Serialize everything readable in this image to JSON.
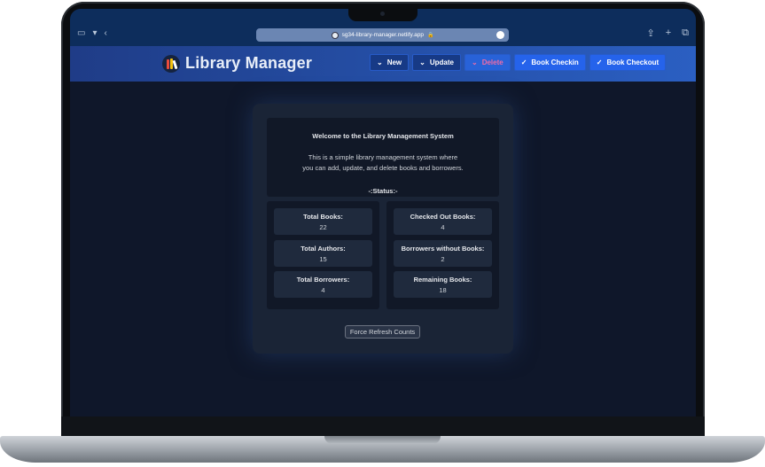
{
  "browser": {
    "url": "sg34-library-manager.netlify.app",
    "lock_glyph": "🔒"
  },
  "app": {
    "title": "Library Manager"
  },
  "nav": {
    "new_label": "New",
    "update_label": "Update",
    "delete_label": "Delete",
    "checkin_label": "Book Checkin",
    "checkout_label": "Book Checkout"
  },
  "welcome": {
    "title": "Welcome to the Library Management System",
    "desc_line1": "This is a simple library management system where",
    "desc_line2": "you can add, update, and delete books and borrowers.",
    "status": "-:Status:-"
  },
  "stats": {
    "left": [
      {
        "label": "Total Books:",
        "value": "22"
      },
      {
        "label": "Total Authors:",
        "value": "15"
      },
      {
        "label": "Total Borrowers:",
        "value": "4"
      }
    ],
    "right": [
      {
        "label": "Checked Out Books:",
        "value": "4"
      },
      {
        "label": "Borrowers without Books:",
        "value": "2"
      },
      {
        "label": "Remaining Books:",
        "value": "18"
      }
    ]
  },
  "refresh_label": "Force Refresh Counts",
  "colors": {
    "page_bg": "#0f172a",
    "header_start": "#1f3c87",
    "header_end": "#2b5fc2",
    "delete_text": "#f06ca6"
  },
  "icons": {
    "chevron": "chevron-down-icon",
    "check": "check-icon"
  }
}
